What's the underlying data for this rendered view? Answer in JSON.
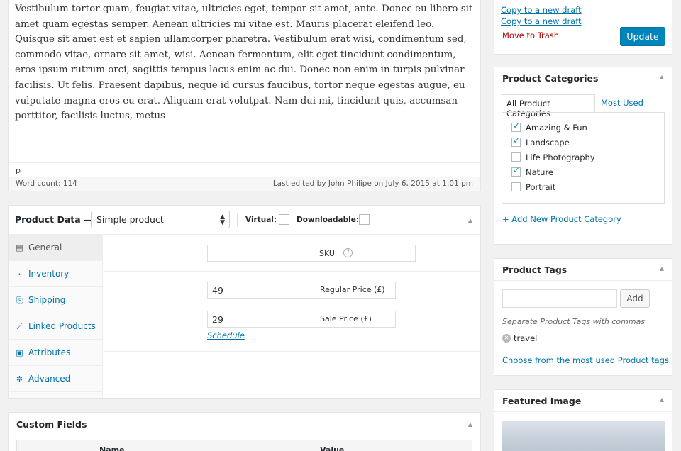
{
  "editor": {
    "body_text": "Vestibulum tortor quam, feugiat vitae, ultricies eget, tempor sit amet, ante. Donec eu libero sit amet quam egestas semper. Aenean ultricies mi vitae est. Mauris placerat eleifend leo. Quisque sit amet est et sapien ullamcorper pharetra. Vestibulum erat wisi, condimentum sed, commodo vitae, ornare sit amet, wisi. Aenean fermentum, elit eget tincidunt condimentum, eros ipsum rutrum orci, sagittis tempus lacus enim ac dui. Donec non enim in turpis pulvinar facilisis. Ut felis. Praesent dapibus, neque id cursus faucibus, tortor neque egestas augue, eu vulputate magna eros eu erat. Aliquam erat volutpat. Nam dui mi, tincidunt quis, accumsan porttitor, facilisis luctus, metus",
    "path": "p",
    "word_count": "Word count: 114",
    "last_edited": "Last edited by John Philipe on July 6, 2015 at 1:01 pm"
  },
  "product_data": {
    "title": "Product Data —",
    "type_value": "Simple product",
    "virtual_label": "Virtual:",
    "downloadable_label": "Downloadable:",
    "tabs": [
      {
        "label": "General",
        "icon": "general-icon",
        "glyph": "▤"
      },
      {
        "label": "Inventory",
        "icon": "inventory-icon",
        "glyph": "⌁"
      },
      {
        "label": "Shipping",
        "icon": "shipping-icon",
        "glyph": "⎘"
      },
      {
        "label": "Linked Products",
        "icon": "link-icon",
        "glyph": "⟋"
      },
      {
        "label": "Attributes",
        "icon": "attributes-icon",
        "glyph": "▣"
      },
      {
        "label": "Advanced",
        "icon": "gear-icon",
        "glyph": "✲"
      }
    ],
    "sku_label": "SKU",
    "regular_price_label": "Regular Price (£)",
    "regular_price_value": "49",
    "sale_price_label": "Sale Price (£)",
    "sale_price_value": "29",
    "schedule_link": "Schedule"
  },
  "custom_fields": {
    "title": "Custom Fields",
    "col_name": "Name",
    "col_value": "Value"
  },
  "publish": {
    "copy_link_1": "Copy to a new draft",
    "copy_link_2": "Copy to a new draft",
    "trash_link": "Move to Trash",
    "update_button": "Update"
  },
  "categories": {
    "title": "Product Categories",
    "tab_all": "All Product Categories",
    "tab_most_used": "Most Used",
    "items": [
      {
        "label": "Amazing & Fun",
        "checked": true
      },
      {
        "label": "Landscape",
        "checked": true
      },
      {
        "label": "Life Photography",
        "checked": false
      },
      {
        "label": "Nature",
        "checked": true
      },
      {
        "label": "Portrait",
        "checked": false
      }
    ],
    "add_new_link": "+ Add New Product Category"
  },
  "tags": {
    "title": "Product Tags",
    "add_button": "Add",
    "hint": "Separate Product Tags with commas",
    "existing_tag": "travel",
    "most_used_link": "Choose from the most used Product tags"
  },
  "featured_image": {
    "title": "Featured Image"
  },
  "colors": {
    "accent": "#0073aa",
    "button": "#0085ba",
    "danger": "#a00"
  }
}
